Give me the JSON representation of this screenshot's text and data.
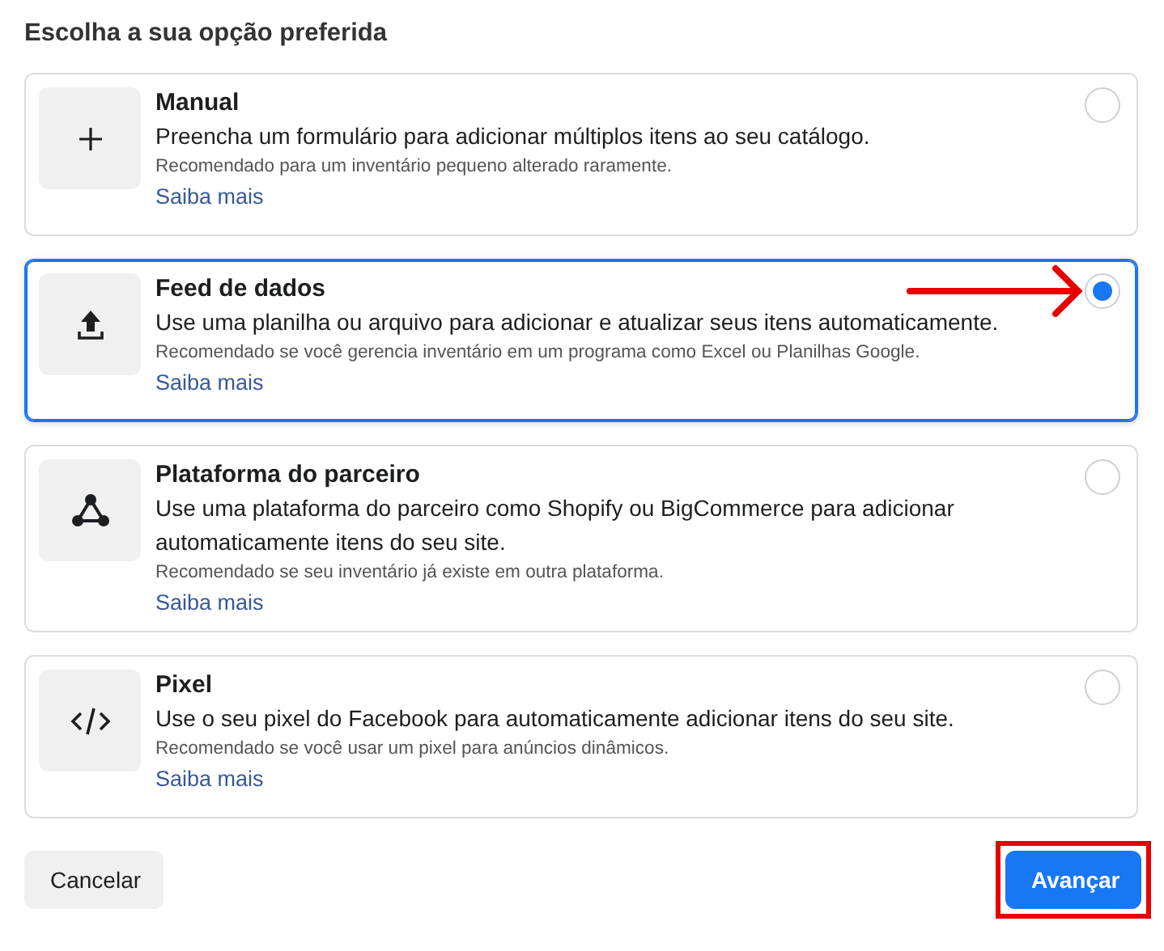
{
  "heading": "Escolha a sua opção preferida",
  "options": [
    {
      "kind": "manual",
      "title": "Manual",
      "description": "Preencha um formulário para adicionar múltiplos itens ao seu catálogo.",
      "note": "Recomendado para um inventário pequeno alterado raramente.",
      "link": "Saiba mais",
      "selected": false,
      "arrow": false
    },
    {
      "kind": "feed",
      "title": "Feed de dados",
      "description": "Use uma planilha ou arquivo para adicionar e atualizar seus itens automaticamente.",
      "note": "Recomendado se você gerencia inventário em um programa como Excel ou Planilhas Google.",
      "link": "Saiba mais",
      "selected": true,
      "arrow": true
    },
    {
      "kind": "partner",
      "title": "Plataforma do parceiro",
      "description": "Use uma plataforma do parceiro como Shopify ou BigCommerce para adicionar automaticamente itens do seu site.",
      "note": "Recomendado se seu inventário já existe em outra plataforma.",
      "link": "Saiba mais",
      "selected": false,
      "arrow": false
    },
    {
      "kind": "pixel",
      "title": "Pixel",
      "description": "Use o seu pixel do Facebook para automaticamente adicionar itens do seu site.",
      "note": "Recomendado se você usar um pixel para anúncios dinâmicos.",
      "link": "Saiba mais",
      "selected": false,
      "arrow": false
    }
  ],
  "cancel": {
    "label": "Cancelar"
  },
  "next": {
    "label": "Avançar",
    "highlighted": true
  }
}
